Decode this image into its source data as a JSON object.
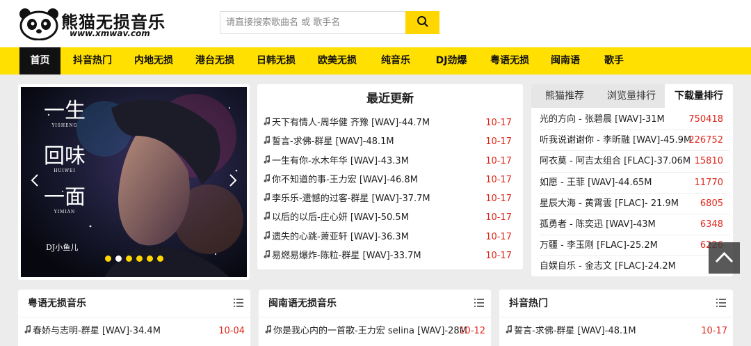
{
  "logo": {
    "title": "熊猫无损音乐",
    "url": "www.xmwav.com",
    "icon": "panda-logo-icon"
  },
  "search": {
    "placeholder": "请直接搜索歌曲名 或 歌手名",
    "value": ""
  },
  "nav": [
    {
      "label": "首页",
      "active": true
    },
    {
      "label": "抖音热门"
    },
    {
      "label": "内地无损"
    },
    {
      "label": "港台无损"
    },
    {
      "label": "日韩无损"
    },
    {
      "label": "欧美无损"
    },
    {
      "label": "纯音乐"
    },
    {
      "label": "DJ劲爆"
    },
    {
      "label": "粤语无损"
    },
    {
      "label": "闽南语"
    },
    {
      "label": "歌手"
    }
  ],
  "slider": {
    "caption": {
      "line1": "一生",
      "line1_sub": "YISHENG",
      "line2": "回味",
      "line2_sub": "HUIWEI",
      "line3": "一面",
      "line3_sub": "YIMIAN",
      "artist": "DJ小鱼儿"
    },
    "dot_count": 6,
    "current_dot": 1
  },
  "latest": {
    "title": "最近更新",
    "items": [
      {
        "name": "天下有情人-周华健 齐豫 [WAV]-44.7M",
        "date": "10-17"
      },
      {
        "name": "誓言-求佛-群星  [WAV]-48.1M",
        "date": "10-17"
      },
      {
        "name": "一生有你-水木年华  [WAV]-43.3M",
        "date": "10-17"
      },
      {
        "name": "你不知道的事-王力宏  [WAV]-46.8M",
        "date": "10-17"
      },
      {
        "name": "李乐乐-遗憾的过客-群星  [WAV]-37.7M",
        "date": "10-17"
      },
      {
        "name": "以后的以后-庄心妍  [WAV]-50.5M",
        "date": "10-17"
      },
      {
        "name": "遗失的心跳-萧亚轩  [WAV]-36.3M",
        "date": "10-17"
      },
      {
        "name": "易燃易爆炸-陈粒-群星  [WAV]-33.7M",
        "date": "10-17"
      }
    ]
  },
  "ranking": {
    "tabs": [
      {
        "label": "熊猫推荐"
      },
      {
        "label": "浏览量排行"
      },
      {
        "label": "下载量排行",
        "active": true
      }
    ],
    "items": [
      {
        "name": "光的方向 - 张碧晨  [WAV]-31M",
        "count": "750418"
      },
      {
        "name": "听我说谢谢你 - 李昕融  [WAV]-45.9M",
        "count": "226752"
      },
      {
        "name": "阿衣莫 - 阿吉太组合  [FLAC]-37.06M",
        "count": "15810"
      },
      {
        "name": "如愿 - 王菲  [WAV]-44.65M",
        "count": "11770"
      },
      {
        "name": "星辰大海 - 黄霄雲  [FLAC]- 21.9M",
        "count": "6805"
      },
      {
        "name": "孤勇者 - 陈奕迅  [WAV]-43M",
        "count": "6348"
      },
      {
        "name": "万疆 - 李玉刚  [FLAC]-25.2M",
        "count": "6226"
      },
      {
        "name": "自娱自乐 - 金志文  [FLAC]-24.2M",
        "count": ""
      }
    ]
  },
  "sections": [
    {
      "title": "粤语无损音乐",
      "first": {
        "name": "春娇与志明-群星  [WAV]-34.4M",
        "date": "10-04"
      }
    },
    {
      "title": "闽南语无损音乐",
      "first": {
        "name": "你是我心内的一首歌-王力宏 selina [WAV]-28M",
        "date": "10-12"
      }
    },
    {
      "title": "抖音热门",
      "first": {
        "name": "誓言-求佛-群星  [WAV]-48.1M",
        "date": "10-17"
      }
    }
  ],
  "colors": {
    "accent": "#ffe000",
    "date_red": "#e0271c",
    "nav_active": "#111111"
  }
}
